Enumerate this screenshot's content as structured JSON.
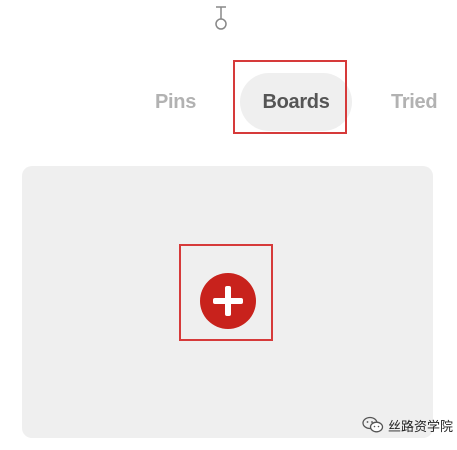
{
  "top_icon": {
    "icon": "pin-icon"
  },
  "tabs": [
    {
      "label": "Pins",
      "selected": false
    },
    {
      "label": "Boards",
      "selected": true
    },
    {
      "label": "Tried",
      "selected": false
    }
  ],
  "board_card": {
    "add_icon": "plus-icon"
  },
  "watermark": {
    "icon": "wechat-icon",
    "text": "丝路资学院"
  },
  "colors": {
    "accent": "#c8221c",
    "highlight": "#d63a3a",
    "card_bg": "#efefef",
    "tab_inactive": "#b2b2b2",
    "tab_active": "#555555"
  }
}
